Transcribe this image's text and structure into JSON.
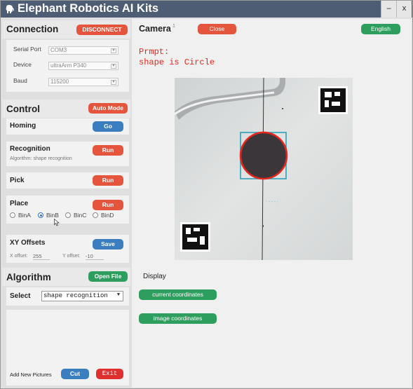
{
  "window": {
    "title": "Elephant Robotics AI Kits",
    "minimize_label": "–",
    "close_label": "x"
  },
  "connection": {
    "title": "Connection",
    "disconnect_label": "DISCONNECT",
    "serial_port_label": "Serial Port",
    "serial_port_value": "COM3",
    "device_label": "Device",
    "device_value": "ultraArm P340",
    "baud_label": "Baud",
    "baud_value": "115200"
  },
  "control": {
    "title": "Control",
    "auto_mode_label": "Auto Mode",
    "homing_label": "Homing",
    "homing_go_label": "Go",
    "recognition_label": "Recognition",
    "recognition_run_label": "Run",
    "algorithm_note": "Algorithm: shape recognition",
    "pick_label": "Pick",
    "pick_run_label": "Run",
    "place_label": "Place",
    "place_run_label": "Run",
    "bins": [
      {
        "label": "BinA",
        "selected": false
      },
      {
        "label": "BinB",
        "selected": true
      },
      {
        "label": "BinC",
        "selected": false
      },
      {
        "label": "BinD",
        "selected": false
      }
    ]
  },
  "offsets": {
    "title": "XY Offsets",
    "save_label": "Save",
    "x_label": "X offset:",
    "x_value": "255",
    "y_label": "Y offset:",
    "y_value": "-10"
  },
  "algorithm": {
    "title": "Algorithm",
    "open_file_label": "Open File",
    "select_label": "Select",
    "select_value": "shape recognition",
    "add_pictures_label": "Add New Pictures",
    "cut_label": "Cut",
    "exit_label": "Exit"
  },
  "camera": {
    "title": "Camera",
    "badge": "1",
    "close_label": "Close",
    "language_label": "English",
    "prompt_line1": "Prmpt:",
    "prompt_line2": "shape is Circle"
  },
  "display": {
    "title": "Display",
    "current_coords_label": "current coordinates",
    "image_coords_label": "image coordinates"
  },
  "colors": {
    "titlebar": "#4d5d74",
    "red_button": "#e5553d",
    "blue_button": "#3a7ebf",
    "green_button": "#2e9e5e",
    "prompt_text": "#e8261b"
  }
}
